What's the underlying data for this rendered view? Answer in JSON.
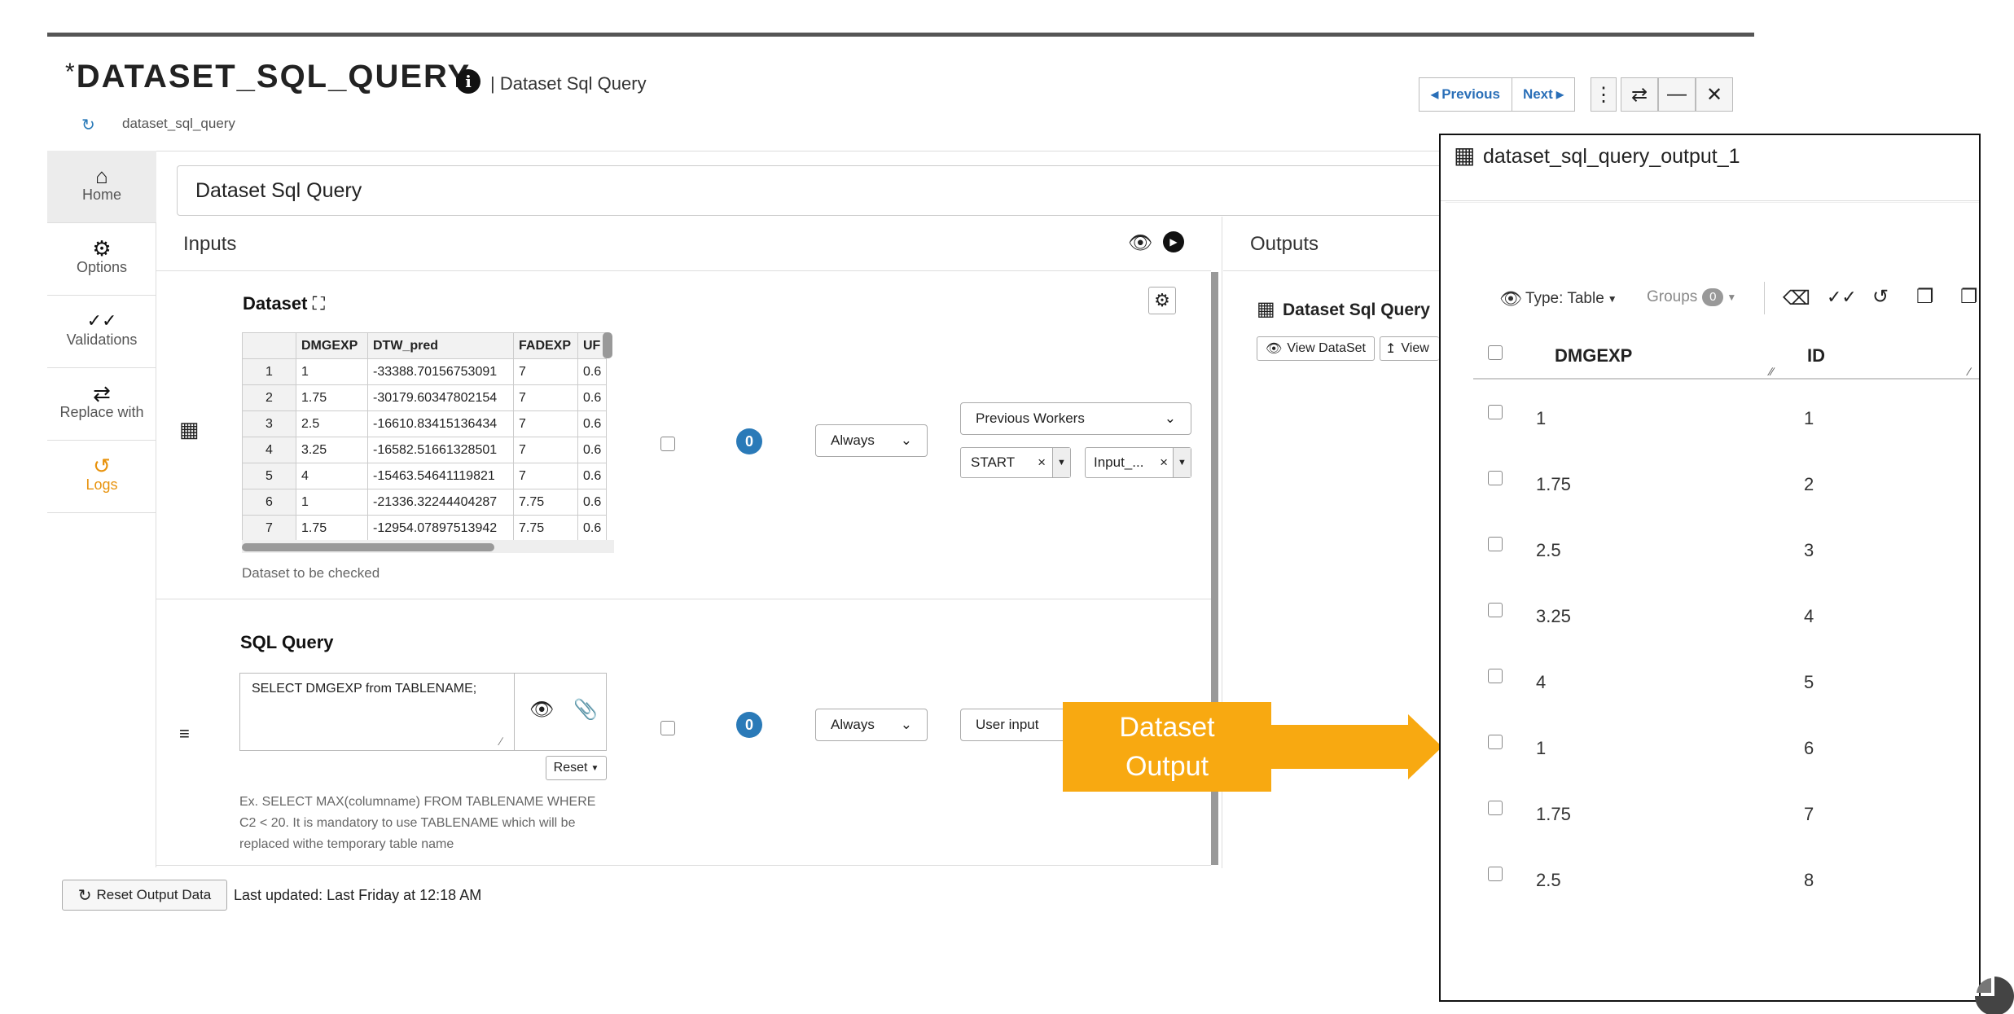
{
  "header": {
    "title_prefix": "*",
    "title": "DATASET_SQL_QUERY",
    "subtitle": "| Dataset Sql Query",
    "path": "dataset_sql_query",
    "prev_label": "Previous",
    "next_label": "Next"
  },
  "sidebar": {
    "items": [
      {
        "label": "Home",
        "icon": "home-icon"
      },
      {
        "label": "Options",
        "icon": "gear-icon"
      },
      {
        "label": "Validations",
        "icon": "double-check-icon"
      },
      {
        "label": "Replace with",
        "icon": "swap-icon"
      },
      {
        "label": "Logs",
        "icon": "history-icon"
      }
    ]
  },
  "main": {
    "name_value": "Dataset Sql Query",
    "inputs_label": "Inputs",
    "outputs_label": "Outputs"
  },
  "dataset_row": {
    "label": "Dataset",
    "columns": [
      "DMGEXP",
      "DTW_pred",
      "FADEXP",
      "UF"
    ],
    "rows": [
      [
        "1",
        "1",
        "-33388.70156753091",
        "7",
        "0.6"
      ],
      [
        "2",
        "1.75",
        "-30179.60347802154",
        "7",
        "0.6"
      ],
      [
        "3",
        "2.5",
        "-16610.83415136434",
        "7",
        "0.6"
      ],
      [
        "4",
        "3.25",
        "-16582.51661328501",
        "7",
        "0.6"
      ],
      [
        "5",
        "4",
        "-15463.54641119821",
        "7",
        "0.6"
      ],
      [
        "6",
        "1",
        "-21336.32244404287",
        "7.75",
        "0.6"
      ],
      [
        "7",
        "1.75",
        "-12954.07897513942",
        "7.75",
        "0.6"
      ]
    ],
    "help": "Dataset to be checked",
    "badge": "0",
    "condition": "Always",
    "source_select": "Previous Workers",
    "tag1": "START",
    "tag2": "Input_..."
  },
  "sql_row": {
    "label": "SQL Query",
    "query": "SELECT DMGEXP from TABLENAME;",
    "reset_label": "Reset",
    "hint": "Ex. SELECT MAX(columname) FROM TABLENAME WHERE C2 < 20. It is mandatory to use TABLENAME which will be replaced withe temporary table name",
    "badge": "0",
    "condition": "Always",
    "source": "User input"
  },
  "outputs": {
    "title": "Dataset Sql Query",
    "view_dataset": "View DataSet",
    "view": "View"
  },
  "footer": {
    "reset_output": "Reset Output Data",
    "last_updated": "Last updated: Last Friday at 12:18 AM"
  },
  "callout": {
    "line1": "Dataset",
    "line2": "Output"
  },
  "output_panel": {
    "title": "dataset_sql_query_output_1",
    "type_label": "Type: Table",
    "groups_label": "Groups",
    "groups_count": "0",
    "columns": [
      "DMGEXP",
      "ID"
    ],
    "rows": [
      [
        "1",
        "1"
      ],
      [
        "1.75",
        "2"
      ],
      [
        "2.5",
        "3"
      ],
      [
        "3.25",
        "4"
      ],
      [
        "4",
        "5"
      ],
      [
        "1",
        "6"
      ],
      [
        "1.75",
        "7"
      ],
      [
        "2.5",
        "8"
      ]
    ]
  },
  "colors": {
    "accent_blue": "#2a7ab8",
    "orange": "#f8a911",
    "logs_orange": "#e8930e"
  }
}
